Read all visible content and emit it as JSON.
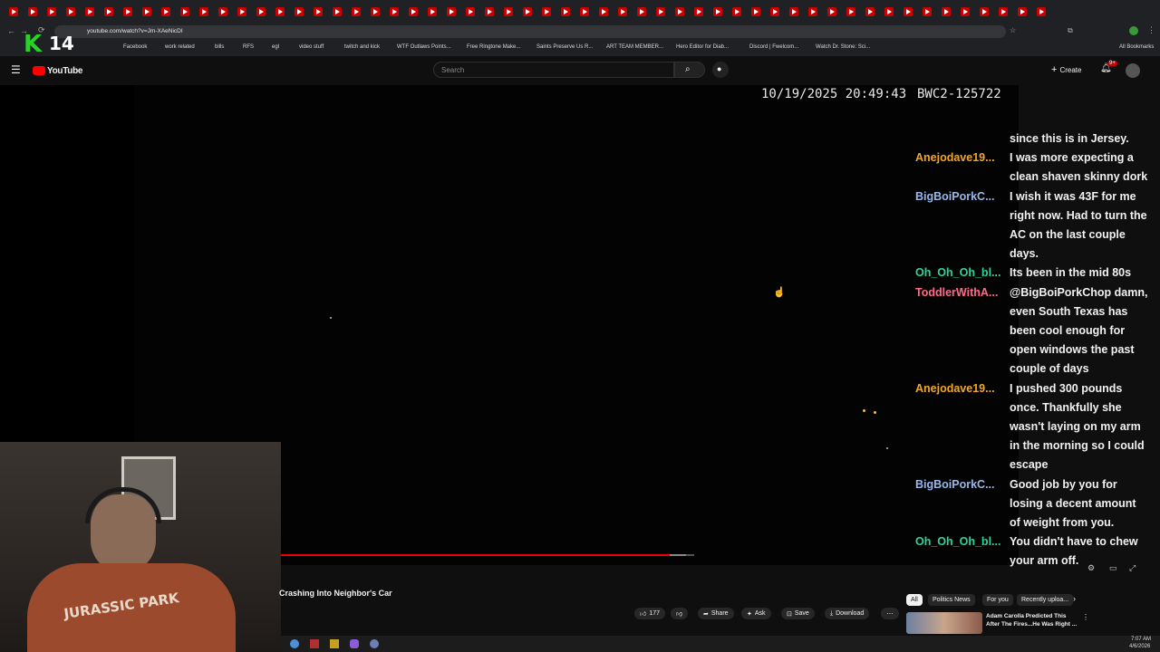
{
  "browser": {
    "url": "youtube.com/watch?v=Jm-XAeNicDI",
    "bookmarks": [
      "Facebook",
      "work related",
      "bills",
      "RFS",
      "egl",
      "video stuff",
      "twitch and kick",
      "WTF Outlaws Points...",
      "Free Ringtone Make...",
      "Saints Preserve Us R...",
      "ART TEAM MEMBER...",
      "Hero Editor for Diab...",
      "Discord | Fwelcom...",
      "Watch Dr. Stone: Sci..."
    ],
    "all_bookmarks": "All Bookmarks"
  },
  "overlay": {
    "channel_logo": "K",
    "number": "14"
  },
  "youtube": {
    "logo_text": "YouTube",
    "search_placeholder": "Search",
    "create_label": "Create",
    "notif_badge": "9+"
  },
  "video": {
    "timestamp": "10/19/2025 20:49:43",
    "camera_id": "BWC2-125722",
    "title": "Crashing Into Neighbor's Car",
    "progress_fraction": 0.94,
    "buffer_fraction": 0.98
  },
  "chat": {
    "lines": [
      {
        "name": "",
        "text": "since this is in Jersey."
      },
      {
        "name": "Anejodave19...",
        "text": "I was more expecting a"
      },
      {
        "name": "",
        "text": "clean shaven skinny dork"
      },
      {
        "name": "BigBoiPorkC...",
        "text": "I wish it was 43F for me"
      },
      {
        "name": "",
        "text": "right now. Had to turn the"
      },
      {
        "name": "",
        "text": "AC on the last couple"
      },
      {
        "name": "",
        "text": "days."
      },
      {
        "name": "Oh_Oh_Oh_bl...",
        "text": "Its been in the mid 80s"
      },
      {
        "name": "ToddlerWithA...",
        "text": "@BigBoiPorkChop damn,"
      },
      {
        "name": "",
        "text": "even South Texas has"
      },
      {
        "name": "",
        "text": "been cool enough for"
      },
      {
        "name": "",
        "text": "open windows the past"
      },
      {
        "name": "",
        "text": "couple of days"
      },
      {
        "name": "Anejodave19...",
        "text": "I pushed 300 pounds"
      },
      {
        "name": "",
        "text": "once. Thankfully she"
      },
      {
        "name": "",
        "text": "wasn't laying on my arm"
      },
      {
        "name": "",
        "text": "in the morning so I could"
      },
      {
        "name": "",
        "text": "escape"
      },
      {
        "name": "BigBoiPorkC...",
        "text": "Good job by you for"
      },
      {
        "name": "",
        "text": "losing a decent amount"
      },
      {
        "name": "",
        "text": "of weight from you."
      },
      {
        "name": "Oh_Oh_Oh_bl...",
        "text": "You didn't have to chew"
      },
      {
        "name": "",
        "text": "your arm off."
      }
    ],
    "colors": {
      "Anejodave19...": "#f5a623",
      "BigBoiPorkC...": "#9ab7e6",
      "Oh_Oh_Oh_bl...": "#2fd39a",
      "ToddlerWithA...": "#ff6b8b"
    }
  },
  "actions": {
    "likes": "177",
    "share": "Share",
    "ask": "Ask",
    "save": "Save",
    "download": "Download"
  },
  "chips": [
    "All",
    "Politics News",
    "For you",
    "Recently uploa..."
  ],
  "recommended": {
    "title_line1": "Adam Carolla Predicted This",
    "title_line2": "After The Fires...He Was Right ..."
  },
  "webcam": {
    "shirt_text": "JURASSIC PARK"
  },
  "taskbar": {
    "time": "7:07 AM",
    "date": "4/6/2026"
  }
}
